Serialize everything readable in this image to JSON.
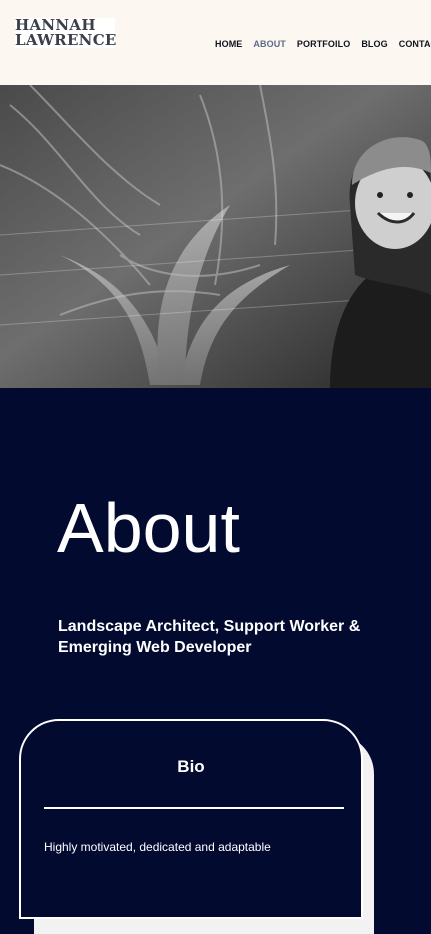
{
  "header": {
    "logo_line1": "HANNAH",
    "logo_line2": "LAWRENCE",
    "nav": [
      {
        "label": "HOME",
        "active": false
      },
      {
        "label": "ABOUT",
        "active": true
      },
      {
        "label": "PORTFOILO",
        "active": false
      },
      {
        "label": "BLOG",
        "active": false
      },
      {
        "label": "CONTACT",
        "active": false
      }
    ]
  },
  "hero": {
    "image": "portrait-photo-grayscale"
  },
  "about": {
    "title": "About",
    "subtitle": "Landscape Architect, Support Worker & Emerging Web Developer"
  },
  "bio": {
    "heading": "Bio",
    "text": "Highly motivated, dedicated and adaptable"
  },
  "colors": {
    "header_bg": "#fdf7f1",
    "section_bg": "#020a30",
    "nav_active": "#5b6b8c",
    "text_light": "#ffffff"
  }
}
